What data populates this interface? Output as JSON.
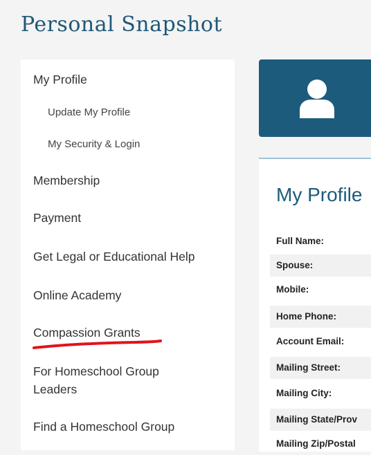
{
  "page": {
    "title": "Personal Snapshot"
  },
  "sidebar": {
    "items": [
      {
        "label": "My Profile"
      },
      {
        "label": "Update My Profile"
      },
      {
        "label": "My Security & Login"
      },
      {
        "label": "Membership"
      },
      {
        "label": "Payment"
      },
      {
        "label": "Get Legal or Educational Help"
      },
      {
        "label": "Online Academy"
      },
      {
        "label": "Compassion Grants"
      },
      {
        "label": "For Homeschool Group"
      },
      {
        "label": "Leaders"
      },
      {
        "label": "Find a Homeschool Group"
      }
    ]
  },
  "banner": {
    "icon": "user-icon"
  },
  "profile": {
    "title": "My Profile",
    "fields": [
      {
        "label": "Full Name:"
      },
      {
        "label": "Spouse:"
      },
      {
        "label": "Mobile:"
      },
      {
        "label": "Home Phone:"
      },
      {
        "label": "Account Email:"
      },
      {
        "label": "Mailing Street:"
      },
      {
        "label": "Mailing City:"
      },
      {
        "label": "Mailing State/Prov"
      },
      {
        "label": "Mailing Zip/Postal"
      }
    ]
  },
  "colors": {
    "accent": "#1c5b7c",
    "annotation": "#e0141a"
  }
}
